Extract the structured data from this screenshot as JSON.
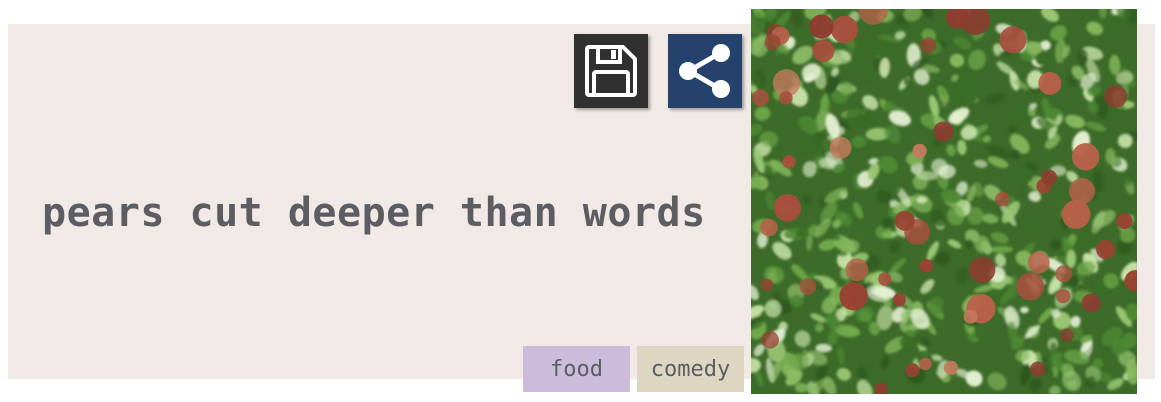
{
  "card": {
    "background_color": "#f1e9e5",
    "quote_text": "pears cut deeper than words",
    "text_color": "#5b5d63"
  },
  "actions": {
    "save": {
      "icon": "floppy-disk-icon",
      "color": "#303030"
    },
    "share": {
      "icon": "share-icon",
      "color": "#24426b"
    }
  },
  "tags": [
    {
      "label": "food",
      "color": "#cbbcdb"
    },
    {
      "label": "comedy",
      "color": "#dcd6c2"
    }
  ],
  "image": {
    "description_icon": "pear-tree-photo"
  }
}
